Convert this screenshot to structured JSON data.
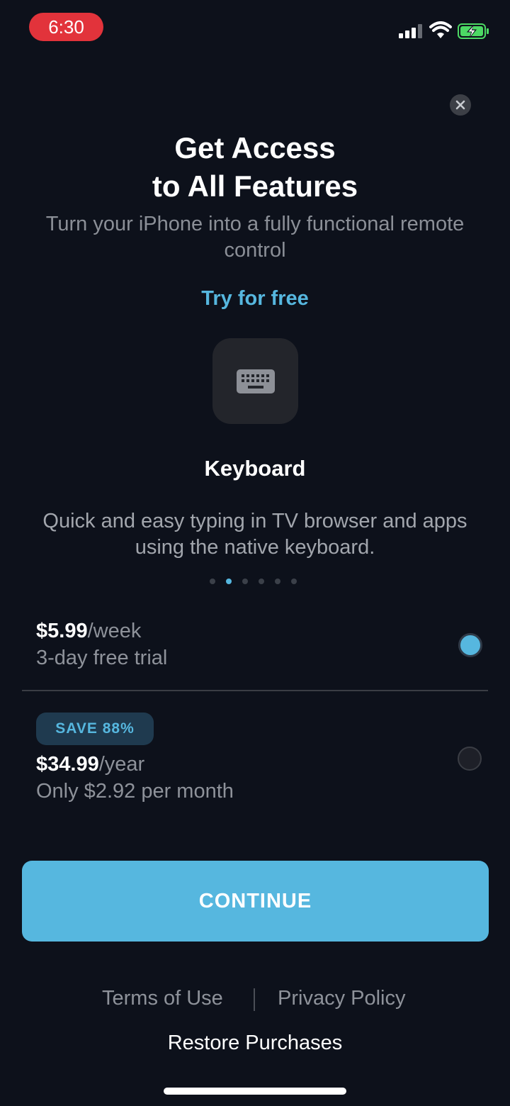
{
  "status_bar": {
    "time": "6:30",
    "icons": [
      "signal-icon",
      "wifi-icon",
      "battery-charging-icon"
    ]
  },
  "header": {
    "title": "Get Access\nto All Features",
    "subtitle": "Turn your iPhone into a fully functional remote control",
    "try_free": "Try for free"
  },
  "feature": {
    "icon": "keyboard-icon",
    "title": "Keyboard",
    "description": "Quick and easy typing in TV browser and apps using the native keyboard."
  },
  "carousel": {
    "total": 6,
    "active_index": 1
  },
  "plans": [
    {
      "price": "$5.99",
      "period": "/week",
      "detail": "3-day free trial",
      "selected": true
    },
    {
      "badge": "SAVE 88%",
      "price": "$34.99",
      "period": "/year",
      "detail": "Only $2.92 per month",
      "selected": false
    }
  ],
  "cta": {
    "label": "CONTINUE"
  },
  "footer": {
    "terms": "Terms of Use",
    "privacy": "Privacy Policy",
    "restore": "Restore Purchases"
  },
  "colors": {
    "background": "#0d111b",
    "accent": "#56b7df",
    "time_pill": "#e2333b",
    "battery": "#4cd964"
  }
}
